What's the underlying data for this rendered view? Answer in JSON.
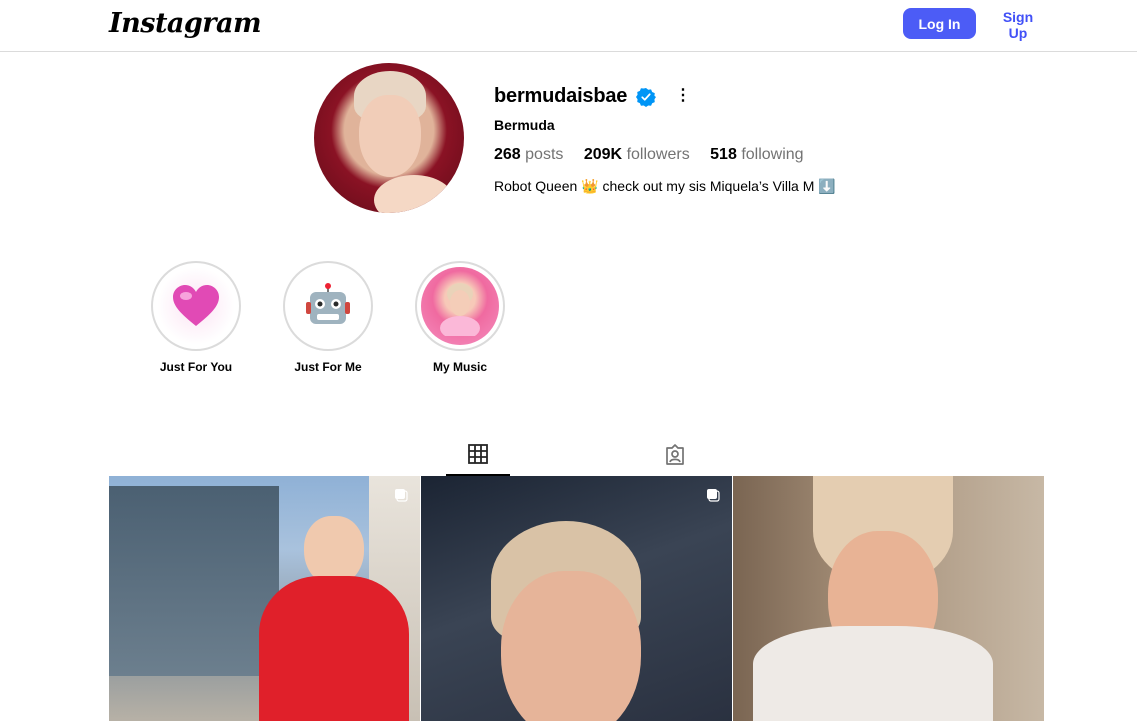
{
  "header": {
    "logo": "Instagram",
    "login_label": "Log In",
    "signup_label": "Sign Up"
  },
  "profile": {
    "username": "bermudaisbae",
    "full_name": "Bermuda",
    "stats": [
      {
        "value": "268",
        "label": "posts"
      },
      {
        "value": "209K",
        "label": "followers"
      },
      {
        "value": "518",
        "label": "following"
      }
    ],
    "bio": "Robot Queen 👑 check out my sis Miquela’s Villa M ⬇️",
    "verified_color": "#0095f6"
  },
  "highlights": [
    {
      "label": "Just For You",
      "icon": "heart-icon",
      "glyph": "💗"
    },
    {
      "label": "Just For Me",
      "icon": "robot-icon",
      "glyph": "🤖"
    },
    {
      "label": "My Music",
      "icon": "portrait-photo",
      "glyph": ""
    }
  ],
  "tabs": [
    {
      "name": "posts-grid",
      "icon": "grid-icon",
      "active": true
    },
    {
      "name": "tagged",
      "icon": "tagged-user-icon",
      "active": false
    }
  ],
  "posts": [
    {
      "kind": "single",
      "icon": "carousel-icon"
    },
    {
      "kind": "carousel",
      "icon": "carousel-icon"
    },
    {
      "kind": "single",
      "icon": ""
    }
  ],
  "colors": {
    "accent": "#4c5cf6",
    "link": "#4150f7",
    "muted": "#737373",
    "divider": "#dbdbdb"
  }
}
